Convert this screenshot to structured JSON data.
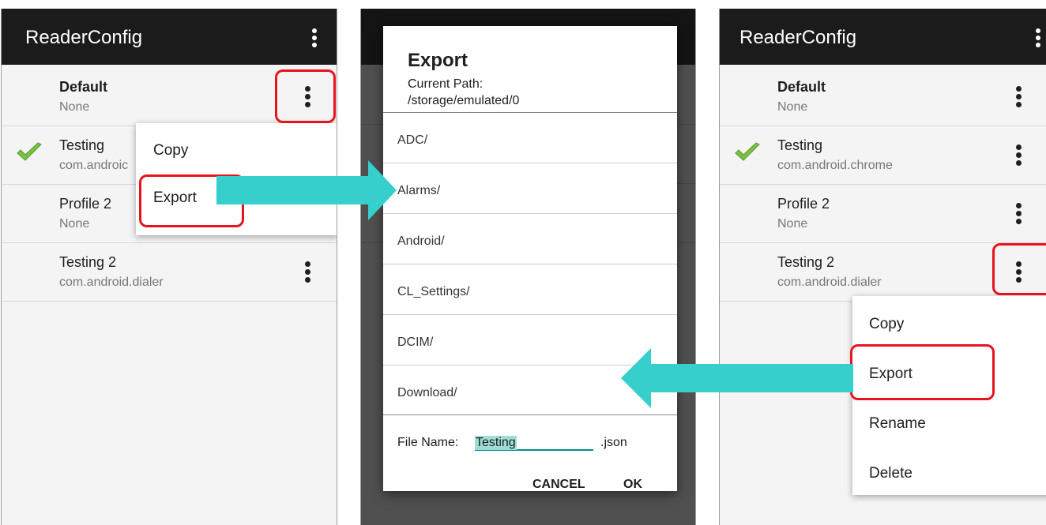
{
  "left_screen": {
    "app_title": "ReaderConfig",
    "profiles": [
      {
        "name": "Default",
        "sub": "None"
      },
      {
        "name": "Testing",
        "sub": "com.android.chrome",
        "sub_visible": "com.androic"
      },
      {
        "name": "Profile 2",
        "sub": "None"
      },
      {
        "name": "Testing 2",
        "sub": "com.android.dialer"
      }
    ],
    "menu": {
      "copy": "Copy",
      "export": "Export"
    }
  },
  "dialog": {
    "title": "Export",
    "path_label": "Current Path:",
    "path_value": "/storage/emulated/0",
    "folders": [
      "ADC/",
      "Alarms/",
      "Android/",
      "CL_Settings/",
      "DCIM/",
      "Download/"
    ],
    "file_name_label": "File Name:",
    "file_name_value": "Testing",
    "file_ext": ".json",
    "cancel": "CANCEL",
    "ok": "OK"
  },
  "right_screen": {
    "app_title": "ReaderConfig",
    "profiles": [
      {
        "name": "Default",
        "sub": "None"
      },
      {
        "name": "Testing",
        "sub": "com.android.chrome"
      },
      {
        "name": "Profile 2",
        "sub": "None"
      },
      {
        "name": "Testing 2",
        "sub": "com.android.dialer"
      }
    ],
    "menu": {
      "copy": "Copy",
      "export": "Export",
      "rename": "Rename",
      "delete": "Delete"
    }
  },
  "colors": {
    "highlight": "#e8141c",
    "arrow": "#36cfcc",
    "appbar": "#1b1b1b",
    "check": "#7ac143",
    "accent": "#008f8f"
  }
}
